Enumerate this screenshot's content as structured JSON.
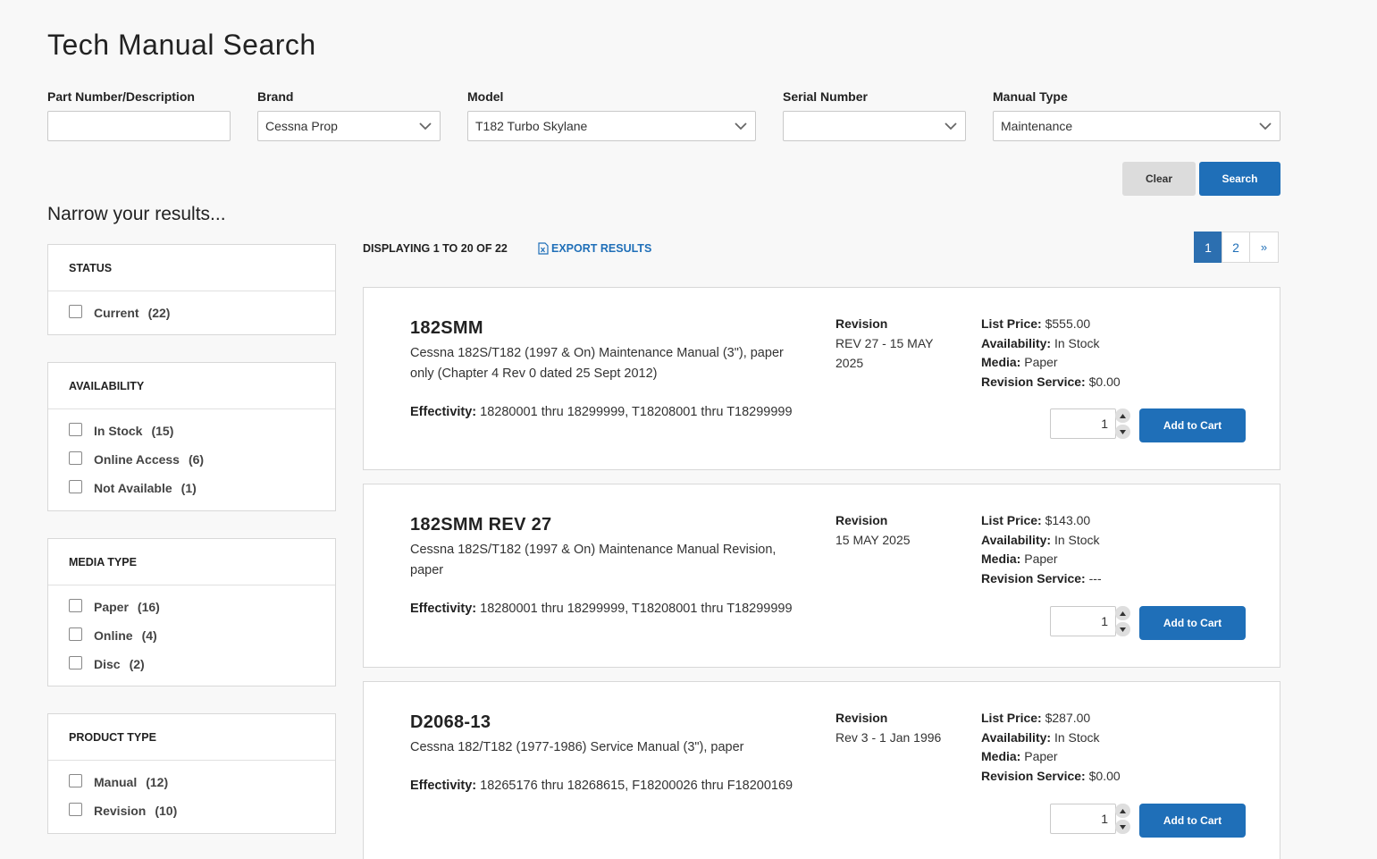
{
  "page": {
    "title": "Tech Manual Search"
  },
  "search": {
    "part_label": "Part Number/Description",
    "part_value": "",
    "brand_label": "Brand",
    "brand_value": "Cessna Prop",
    "model_label": "Model",
    "model_value": "T182 Turbo Skylane",
    "serial_label": "Serial Number",
    "serial_value": "",
    "manual_type_label": "Manual Type",
    "manual_type_value": "Maintenance",
    "clear_label": "Clear",
    "search_label": "Search"
  },
  "filters": {
    "title": "Narrow your results...",
    "groups": [
      {
        "title": "STATUS",
        "options": [
          {
            "label": "Current",
            "count": "(22)"
          }
        ]
      },
      {
        "title": "AVAILABILITY",
        "options": [
          {
            "label": "In Stock",
            "count": "(15)"
          },
          {
            "label": "Online Access",
            "count": "(6)"
          },
          {
            "label": "Not Available",
            "count": "(1)"
          }
        ]
      },
      {
        "title": "MEDIA TYPE",
        "options": [
          {
            "label": "Paper",
            "count": "(16)"
          },
          {
            "label": "Online",
            "count": "(4)"
          },
          {
            "label": "Disc",
            "count": "(2)"
          }
        ]
      },
      {
        "title": "PRODUCT TYPE",
        "options": [
          {
            "label": "Manual",
            "count": "(12)"
          },
          {
            "label": "Revision",
            "count": "(10)"
          }
        ]
      }
    ]
  },
  "results": {
    "display_text": "DISPLAYING 1 TO 20 OF 22",
    "export_label": "EXPORT RESULTS",
    "pagination": {
      "pages": [
        "1",
        "2"
      ],
      "current": "1",
      "next": "»"
    },
    "labels": {
      "revision": "Revision",
      "effectivity": "Effectivity:",
      "list_price": "List Price:",
      "availability": "Availability:",
      "media": "Media:",
      "revision_service": "Revision Service:",
      "add_to_cart": "Add to Cart"
    },
    "items": [
      {
        "part": "182SMM",
        "description": "Cessna 182S/T182 (1997 & On) Maintenance Manual (3\"), paper only (Chapter 4 Rev 0 dated 25 Sept 2012)",
        "effectivity": "18280001 thru 18299999, T18208001 thru T18299999",
        "revision": "REV 27 - 15 MAY 2025",
        "list_price": "$555.00",
        "availability": "In Stock",
        "media": "Paper",
        "revision_service": "$0.00",
        "qty": "1"
      },
      {
        "part": "182SMM REV 27",
        "description": "Cessna 182S/T182 (1997 & On) Maintenance Manual Revision, paper",
        "effectivity": "18280001 thru 18299999, T18208001 thru T18299999",
        "revision": "15 MAY 2025",
        "list_price": "$143.00",
        "availability": "In Stock",
        "media": "Paper",
        "revision_service": "---",
        "qty": "1"
      },
      {
        "part": "D2068-13",
        "description": "Cessna 182/T182 (1977-1986) Service Manual (3\"), paper",
        "effectivity": "18265176 thru 18268615, F18200026 thru F18200169",
        "revision": "Rev 3 - 1 Jan 1996",
        "list_price": "$287.00",
        "availability": "In Stock",
        "media": "Paper",
        "revision_service": "$0.00",
        "qty": "1"
      }
    ]
  }
}
